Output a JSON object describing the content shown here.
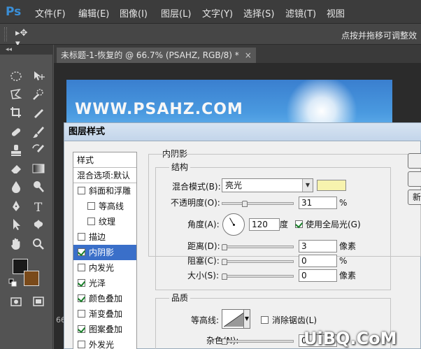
{
  "app": {
    "logo_text": "Ps"
  },
  "menu": [
    {
      "label": "文件(F)"
    },
    {
      "label": "编辑(E)"
    },
    {
      "label": "图像(I)"
    },
    {
      "label": "图层(L)"
    },
    {
      "label": "文字(Y)"
    },
    {
      "label": "选择(S)"
    },
    {
      "label": "滤镜(T)"
    },
    {
      "label": "视图"
    }
  ],
  "options_bar": {
    "tool_glyph": "▸✥ ▾",
    "hint": "点按并拖移可调整效"
  },
  "tools_panel": {
    "header": "◂◂",
    "foreground_color": "#1a1a1a",
    "background_color": "#7a4a1a"
  },
  "document": {
    "tab_title": "未标题-1-恢复的 @ 66.7% (PSAHZ, RGB/8) *",
    "tab_close": "×",
    "canvas_text": "WWW.PSAHZ.COM",
    "zoom_readout": "66"
  },
  "dialog": {
    "title": "图层样式",
    "style_list": {
      "header": "样式",
      "blend_options": "混合选项:默认",
      "items": [
        {
          "label": "斜面和浮雕",
          "checked": false,
          "indent": false,
          "selected": false
        },
        {
          "label": "等高线",
          "checked": false,
          "indent": true,
          "selected": false
        },
        {
          "label": "纹理",
          "checked": false,
          "indent": true,
          "selected": false
        },
        {
          "label": "描边",
          "checked": false,
          "indent": false,
          "selected": false
        },
        {
          "label": "内阴影",
          "checked": true,
          "indent": false,
          "selected": true
        },
        {
          "label": "内发光",
          "checked": false,
          "indent": false,
          "selected": false
        },
        {
          "label": "光泽",
          "checked": true,
          "indent": false,
          "selected": false
        },
        {
          "label": "颜色叠加",
          "checked": true,
          "indent": false,
          "selected": false
        },
        {
          "label": "渐变叠加",
          "checked": false,
          "indent": false,
          "selected": false
        },
        {
          "label": "图案叠加",
          "checked": true,
          "indent": false,
          "selected": false
        },
        {
          "label": "外发光",
          "checked": false,
          "indent": false,
          "selected": false
        }
      ]
    },
    "inner_shadow": {
      "section_title": "内阴影",
      "structure_title": "结构",
      "blend_mode_label": "混合模式(B):",
      "blend_mode_value": "亮光",
      "shadow_color": "#f7f3ae",
      "opacity_label": "不透明度(O):",
      "opacity_value": "31",
      "opacity_unit": "%",
      "angle_label": "角度(A):",
      "angle_value": "120",
      "angle_unit": "度",
      "global_light_label": "使用全局光(G)",
      "global_light_checked": true,
      "distance_label": "距离(D):",
      "distance_value": "3",
      "distance_unit": "像素",
      "choke_label": "阻塞(C):",
      "choke_value": "0",
      "choke_unit": "%",
      "size_label": "大小(S):",
      "size_value": "0",
      "size_unit": "像素",
      "quality_title": "品质",
      "contour_label": "等高线:",
      "anti_alias_label": "消除锯齿(L)",
      "anti_alias_checked": false,
      "noise_label": "杂色(N):",
      "noise_value": "0"
    },
    "buttons": {
      "new_fragment": "新"
    }
  },
  "watermark": "UiBQ.CoM"
}
